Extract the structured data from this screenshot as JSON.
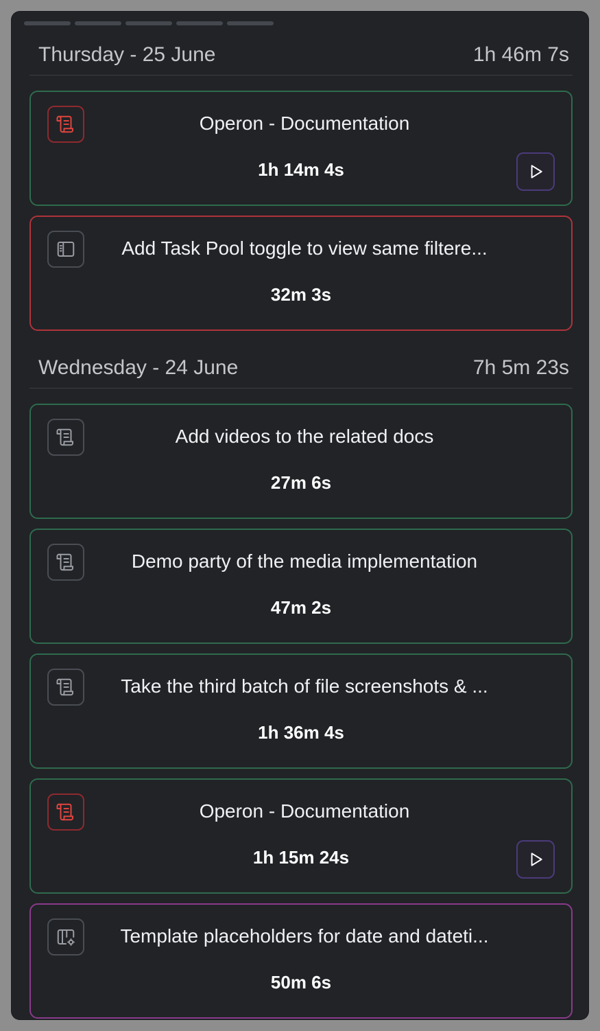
{
  "days": [
    {
      "label": "Thursday - 25 June",
      "total": "1h 46m 7s",
      "entries": [
        {
          "title": "Operon - Documentation",
          "duration": "1h 14m 4s",
          "icon": "scroll-icon",
          "icon_color": "#e0443e",
          "border": "#2f6b4d",
          "playable": true
        },
        {
          "title": "Add Task Pool toggle to view same filtere...",
          "duration": "32m 3s",
          "icon": "sidebar-panel-icon",
          "icon_color": "#9a9da3",
          "border": "#b0333a",
          "playable": false
        }
      ]
    },
    {
      "label": "Wednesday - 24 June",
      "total": "7h 5m 23s",
      "entries": [
        {
          "title": "Add videos to the related docs",
          "duration": "27m 6s",
          "icon": "scroll-icon",
          "icon_color": "#9a9da3",
          "border": "#2f6b4d",
          "playable": false
        },
        {
          "title": "Demo party of the media implementation",
          "duration": "47m 2s",
          "icon": "scroll-icon",
          "icon_color": "#9a9da3",
          "border": "#2f6b4d",
          "playable": false
        },
        {
          "title": "Take the third batch of file screenshots & ...",
          "duration": "1h 36m 4s",
          "icon": "scroll-icon",
          "icon_color": "#9a9da3",
          "border": "#2f6b4d",
          "playable": false
        },
        {
          "title": "Operon - Documentation",
          "duration": "1h 15m 24s",
          "icon": "scroll-icon",
          "icon_color": "#e0443e",
          "border": "#2f6b4d",
          "playable": true
        },
        {
          "title": "Template placeholders for date and dateti...",
          "duration": "50m 6s",
          "icon": "layout-settings-icon",
          "icon_color": "#9a9da3",
          "border": "#8a3a8a",
          "playable": false
        }
      ]
    }
  ]
}
